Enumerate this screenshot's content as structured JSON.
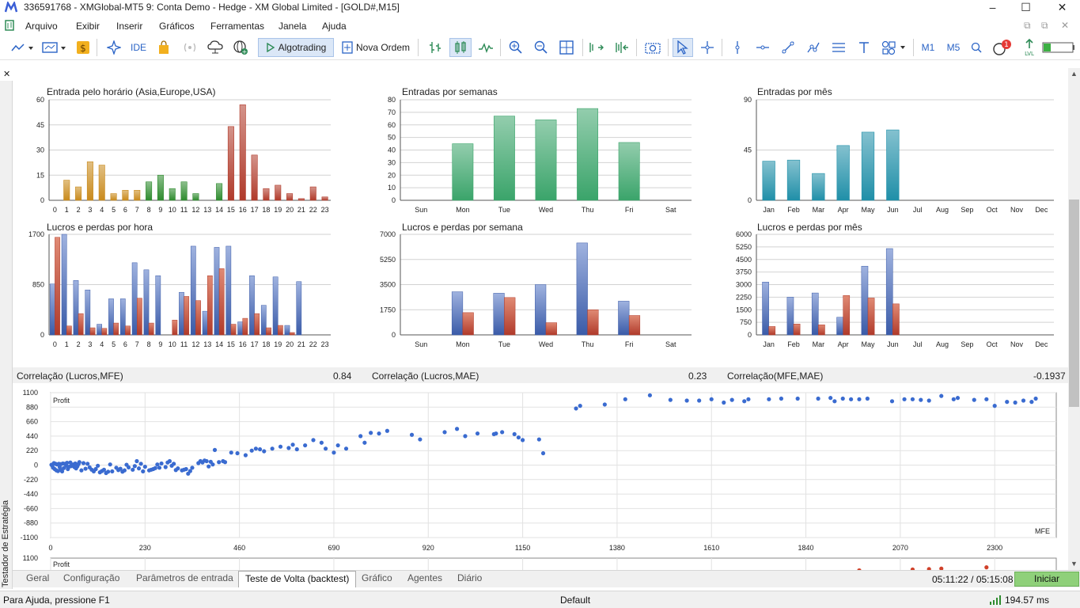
{
  "window": {
    "title": "336591768 - XMGlobal-MT5 9: Conta Demo - Hedge - XM Global Limited - [GOLD#,M15]",
    "controls": [
      "–",
      "☐",
      "✕"
    ]
  },
  "menu": {
    "items": [
      "Arquivo",
      "Exibir",
      "Inserir",
      "Gráficos",
      "Ferramentas",
      "Janela",
      "Ajuda"
    ],
    "mdi_controls": [
      "⧉",
      "⧉",
      "✕"
    ]
  },
  "toolbar": {
    "ide_label": "IDE",
    "algotrading_label": "Algotrading",
    "new_order_label": "Nova Ordem",
    "m1_label": "M1",
    "m5_label": "M5",
    "notification_count": "1",
    "lvl_label": "LVL"
  },
  "panel": {
    "close_glyph": "✕",
    "vertical_title": "Testador de Estratégia"
  },
  "colors": {
    "orange": "#c98a1c",
    "green": "#2e8b2e",
    "red": "#b03a2a",
    "light_red": "#e08a74",
    "blue": "#3a5ba8",
    "light_blue": "#9fb2df",
    "weekday_green": "#3aa46a",
    "month_teal": "#1f8fa8",
    "scatter_blue": "#3a6bd0",
    "scatter_red": "#d0412a"
  },
  "chart_data": [
    {
      "type": "bar",
      "title": "Entrada pelo horário (Asia,Europe,USA)",
      "categories": [
        "0",
        "1",
        "2",
        "3",
        "4",
        "5",
        "6",
        "7",
        "8",
        "9",
        "10",
        "11",
        "12",
        "13",
        "14",
        "15",
        "16",
        "17",
        "18",
        "19",
        "20",
        "21",
        "22",
        "23"
      ],
      "values": [
        0,
        12,
        8,
        23,
        21,
        4,
        6,
        6,
        11,
        15,
        7,
        11,
        4,
        0,
        10,
        44,
        57,
        27,
        7,
        9,
        4,
        1,
        8,
        2
      ],
      "session_colors": [
        "orange",
        "orange",
        "orange",
        "orange",
        "orange",
        "orange",
        "orange",
        "orange",
        "green",
        "green",
        "green",
        "green",
        "green",
        "green",
        "green",
        "red",
        "red",
        "red",
        "red",
        "red",
        "red",
        "red",
        "red",
        "red"
      ],
      "yticks": [
        "0",
        "15",
        "30",
        "45",
        "60"
      ],
      "ylim": [
        0,
        60
      ]
    },
    {
      "type": "bar",
      "title": "Entradas por semanas",
      "categories": [
        "Sun",
        "Mon",
        "Tue",
        "Wed",
        "Thu",
        "Fri",
        "Sat"
      ],
      "values": [
        0,
        45,
        67,
        64,
        73,
        46,
        0
      ],
      "yticks": [
        "0",
        "10",
        "20",
        "30",
        "40",
        "50",
        "60",
        "70",
        "80"
      ],
      "ylim": [
        0,
        80
      ]
    },
    {
      "type": "bar",
      "title": "Entradas por mês",
      "categories": [
        "Jan",
        "Feb",
        "Mar",
        "Apr",
        "May",
        "Jun",
        "Jul",
        "Aug",
        "Sep",
        "Oct",
        "Nov",
        "Dec"
      ],
      "values": [
        35,
        36,
        24,
        49,
        61,
        63,
        0,
        0,
        0,
        0,
        0,
        0
      ],
      "yticks": [
        "0",
        "45",
        "90"
      ],
      "ylim": [
        0,
        90
      ]
    },
    {
      "type": "bar",
      "title": "Lucros e perdas por hora",
      "categories": [
        "0",
        "1",
        "2",
        "3",
        "4",
        "5",
        "6",
        "7",
        "8",
        "9",
        "10",
        "11",
        "12",
        "13",
        "14",
        "15",
        "16",
        "17",
        "18",
        "19",
        "20",
        "21",
        "22",
        "23"
      ],
      "series": [
        {
          "values": [
            860,
            1700,
            920,
            760,
            180,
            610,
            610,
            1220,
            1100,
            1000,
            0,
            720,
            1500,
            400,
            1480,
            1500,
            220,
            1000,
            500,
            980,
            160,
            900,
            0,
            0
          ]
        },
        {
          "values": [
            1650,
            150,
            360,
            120,
            110,
            200,
            150,
            620,
            200,
            0,
            250,
            650,
            580,
            1000,
            1120,
            180,
            280,
            360,
            120,
            160,
            40,
            0,
            0,
            0
          ]
        }
      ],
      "yticks": [
        "0",
        "850",
        "1700"
      ],
      "ylim": [
        0,
        1700
      ]
    },
    {
      "type": "bar",
      "title": "Lucros e perdas por semana",
      "categories": [
        "Sun",
        "Mon",
        "Tue",
        "Wed",
        "Thu",
        "Fri",
        "Sat"
      ],
      "series": [
        {
          "values": [
            0,
            3000,
            2900,
            3500,
            6400,
            2350,
            0
          ]
        },
        {
          "values": [
            0,
            1550,
            2600,
            850,
            1750,
            1350,
            0
          ]
        }
      ],
      "yticks": [
        "0",
        "1750",
        "3500",
        "5250",
        "7000"
      ],
      "ylim": [
        0,
        7000
      ]
    },
    {
      "type": "bar",
      "title": "Lucros e perdas por mês",
      "categories": [
        "Jan",
        "Feb",
        "Mar",
        "Apr",
        "May",
        "Jun",
        "Jul",
        "Aug",
        "Sep",
        "Oct",
        "Nov",
        "Dec"
      ],
      "series": [
        {
          "values": [
            3150,
            2250,
            2500,
            1050,
            4100,
            5150,
            0,
            0,
            0,
            0,
            0,
            0
          ]
        },
        {
          "values": [
            500,
            650,
            600,
            2350,
            2200,
            1850,
            0,
            0,
            0,
            0,
            0,
            0
          ]
        }
      ],
      "yticks": [
        "0",
        "750",
        "1500",
        "2250",
        "3000",
        "3750",
        "4500",
        "5250",
        "6000"
      ],
      "ylim": [
        0,
        6000
      ]
    },
    {
      "type": "scatter",
      "inner_label": "Profit",
      "corner_label": "MFE",
      "xticks": [
        "0",
        "230",
        "460",
        "690",
        "920",
        "1150",
        "1380",
        "1610",
        "1840",
        "2070",
        "2300"
      ],
      "xlim": [
        0,
        2450
      ],
      "yticks": [
        "1100",
        "880",
        "660",
        "440",
        "220",
        "0",
        "-220",
        "-440",
        "-660",
        "-880",
        "-1100"
      ],
      "ylim": [
        -1100,
        1100
      ],
      "points": [
        [
          2,
          5
        ],
        [
          4,
          -10
        ],
        [
          6,
          -40
        ],
        [
          8,
          30
        ],
        [
          10,
          -60
        ],
        [
          12,
          20
        ],
        [
          14,
          -80
        ],
        [
          15,
          10
        ],
        [
          18,
          -90
        ],
        [
          20,
          20
        ],
        [
          22,
          -30
        ],
        [
          24,
          -70
        ],
        [
          25,
          15
        ],
        [
          28,
          -95
        ],
        [
          30,
          25
        ],
        [
          32,
          -45
        ],
        [
          35,
          20
        ],
        [
          38,
          -10
        ],
        [
          40,
          35
        ],
        [
          42,
          -60
        ],
        [
          45,
          -25
        ],
        [
          48,
          40
        ],
        [
          50,
          -15
        ],
        [
          52,
          -5
        ],
        [
          55,
          10
        ],
        [
          58,
          -30
        ],
        [
          60,
          25
        ],
        [
          62,
          -50
        ],
        [
          65,
          -20
        ],
        [
          68,
          15
        ],
        [
          70,
          45
        ],
        [
          75,
          -80
        ],
        [
          80,
          30
        ],
        [
          85,
          -55
        ],
        [
          90,
          20
        ],
        [
          95,
          -35
        ],
        [
          100,
          -70
        ],
        [
          105,
          -95
        ],
        [
          110,
          -60
        ],
        [
          115,
          -10
        ],
        [
          120,
          -110
        ],
        [
          125,
          -90
        ],
        [
          130,
          -70
        ],
        [
          135,
          -120
        ],
        [
          140,
          -100
        ],
        [
          145,
          10
        ],
        [
          150,
          -95
        ],
        [
          160,
          -40
        ],
        [
          165,
          -75
        ],
        [
          170,
          -55
        ],
        [
          175,
          -100
        ],
        [
          180,
          -80
        ],
        [
          185,
          5
        ],
        [
          190,
          -35
        ],
        [
          200,
          -70
        ],
        [
          205,
          -15
        ],
        [
          210,
          60
        ],
        [
          215,
          -50
        ],
        [
          220,
          20
        ],
        [
          225,
          -95
        ],
        [
          230,
          -25
        ],
        [
          240,
          -80
        ],
        [
          245,
          -70
        ],
        [
          250,
          -60
        ],
        [
          255,
          -45
        ],
        [
          260,
          10
        ],
        [
          265,
          -40
        ],
        [
          270,
          25
        ],
        [
          280,
          -30
        ],
        [
          285,
          40
        ],
        [
          290,
          60
        ],
        [
          295,
          -10
        ],
        [
          300,
          20
        ],
        [
          305,
          -75
        ],
        [
          310,
          -50
        ],
        [
          320,
          -80
        ],
        [
          325,
          -70
        ],
        [
          330,
          -60
        ],
        [
          335,
          -130
        ],
        [
          340,
          -90
        ],
        [
          345,
          -40
        ],
        [
          360,
          30
        ],
        [
          365,
          60
        ],
        [
          370,
          40
        ],
        [
          375,
          70
        ],
        [
          380,
          60
        ],
        [
          385,
          -20
        ],
        [
          390,
          50
        ],
        [
          395,
          10
        ],
        [
          400,
          230
        ],
        [
          410,
          45
        ],
        [
          420,
          60
        ],
        [
          425,
          45
        ],
        [
          440,
          190
        ],
        [
          455,
          180
        ],
        [
          475,
          150
        ],
        [
          490,
          220
        ],
        [
          500,
          250
        ],
        [
          510,
          240
        ],
        [
          520,
          210
        ],
        [
          540,
          250
        ],
        [
          560,
          280
        ],
        [
          580,
          260
        ],
        [
          590,
          310
        ],
        [
          600,
          240
        ],
        [
          620,
          300
        ],
        [
          640,
          380
        ],
        [
          660,
          340
        ],
        [
          670,
          250
        ],
        [
          690,
          190
        ],
        [
          700,
          300
        ],
        [
          720,
          250
        ],
        [
          755,
          440
        ],
        [
          765,
          340
        ],
        [
          780,
          490
        ],
        [
          800,
          480
        ],
        [
          820,
          520
        ],
        [
          880,
          460
        ],
        [
          900,
          390
        ],
        [
          960,
          500
        ],
        [
          990,
          550
        ],
        [
          1010,
          440
        ],
        [
          1040,
          480
        ],
        [
          1080,
          470
        ],
        [
          1085,
          480
        ],
        [
          1100,
          500
        ],
        [
          1130,
          470
        ],
        [
          1140,
          420
        ],
        [
          1150,
          380
        ],
        [
          1190,
          390
        ],
        [
          1200,
          180
        ],
        [
          1280,
          860
        ],
        [
          1290,
          900
        ],
        [
          1350,
          920
        ],
        [
          1400,
          1000
        ],
        [
          1460,
          1060
        ],
        [
          1510,
          990
        ],
        [
          1640,
          950
        ],
        [
          1690,
          970
        ],
        [
          1750,
          1000
        ],
        [
          1820,
          1010
        ],
        [
          1870,
          1010
        ],
        [
          1910,
          970
        ],
        [
          1950,
          1000
        ],
        [
          1970,
          1000
        ],
        [
          2050,
          970
        ],
        [
          2100,
          1000
        ],
        [
          2140,
          980
        ],
        [
          2170,
          1050
        ],
        [
          2250,
          990
        ],
        [
          2300,
          900
        ],
        [
          2350,
          950
        ],
        [
          2390,
          960
        ],
        [
          1550,
          980
        ],
        [
          1580,
          980
        ],
        [
          1610,
          1000
        ],
        [
          1660,
          990
        ],
        [
          1700,
          1000
        ],
        [
          1780,
          1010
        ],
        [
          1900,
          1020
        ],
        [
          1930,
          1010
        ],
        [
          1990,
          1010
        ],
        [
          2080,
          1000
        ],
        [
          2120,
          990
        ],
        [
          2200,
          1000
        ],
        [
          2210,
          1020
        ],
        [
          2280,
          1000
        ],
        [
          2330,
          960
        ],
        [
          2370,
          980
        ],
        [
          2400,
          1010
        ]
      ]
    },
    {
      "type": "scatter",
      "inner_label": "Profit",
      "yticks": [
        "1100"
      ],
      "ylim": [
        0,
        1100
      ],
      "points": [
        [
          1970,
          10
        ],
        [
          2100,
          30
        ],
        [
          2140,
          40
        ],
        [
          2170,
          50
        ],
        [
          2280,
          80
        ]
      ]
    }
  ],
  "correlation": {
    "labels": [
      "Correlação (Lucros,MFE)",
      "Correlação (Lucros,MAE)",
      "Correlação(MFE,MAE)"
    ],
    "values": [
      "0.84",
      "0.23",
      "-0.1937"
    ]
  },
  "tabs": {
    "items": [
      "Geral",
      "Configuração",
      "Parâmetros de entrada",
      "Teste de Volta (backtest)",
      "Gráfico",
      "Agentes",
      "Diário"
    ],
    "active_index": 3,
    "timer": "05:11:22 / 05:15:08",
    "start_label": "Iniciar"
  },
  "status": {
    "help_text": "Para Ajuda, pressione F1",
    "profile": "Default",
    "ping": "194.57 ms"
  }
}
